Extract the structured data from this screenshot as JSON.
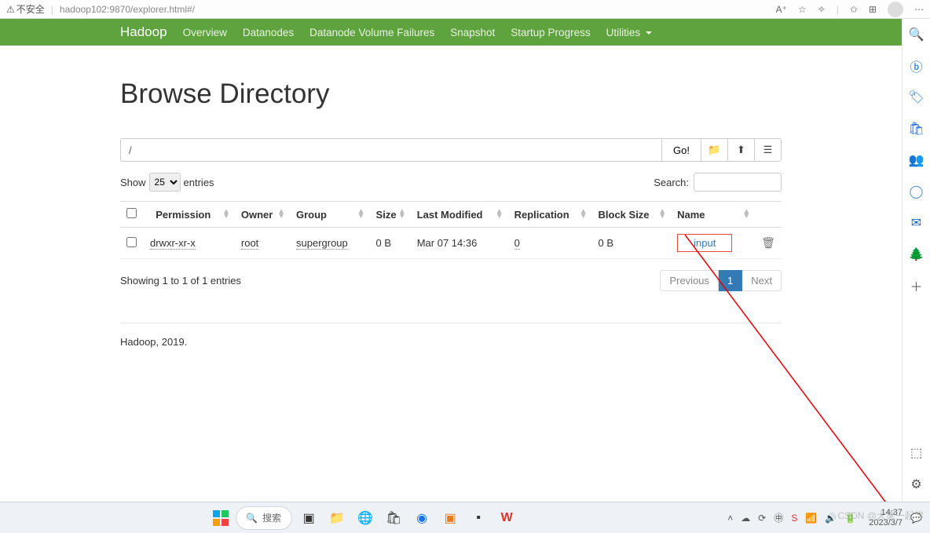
{
  "browser": {
    "insecure_label": "不安全",
    "url_host": "hadoop102",
    "url_port": ":9870",
    "url_path": "/explorer.html#/"
  },
  "nav": {
    "brand": "Hadoop",
    "items": [
      "Overview",
      "Datanodes",
      "Datanode Volume Failures",
      "Snapshot",
      "Startup Progress",
      "Utilities"
    ]
  },
  "page": {
    "title": "Browse Directory",
    "path_value": "/",
    "go_label": "Go!",
    "show_label": "Show",
    "entries_label": "entries",
    "page_size": "25",
    "search_label": "Search:",
    "columns": [
      "Permission",
      "Owner",
      "Group",
      "Size",
      "Last Modified",
      "Replication",
      "Block Size",
      "Name"
    ],
    "rows": [
      {
        "permission": "drwxr-xr-x",
        "owner": "root",
        "group": "supergroup",
        "size": "0 B",
        "modified": "Mar 07 14:36",
        "replication": "0",
        "block_size": "0 B",
        "name": "input"
      }
    ],
    "info_text": "Showing 1 to 1 of 1 entries",
    "pagination": {
      "prev": "Previous",
      "page": "1",
      "next": "Next"
    },
    "footer": "Hadoop, 2019."
  },
  "taskbar": {
    "search_placeholder": "搜索",
    "time": "14:37",
    "date": "2023/3/7"
  },
  "watermark": "CSDN @大家一起学"
}
